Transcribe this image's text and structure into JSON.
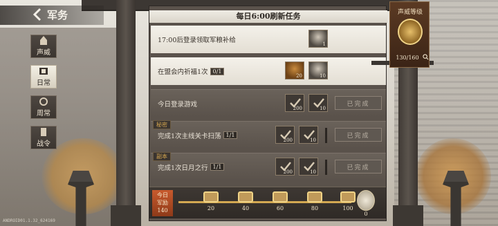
{
  "header": {
    "title": "军务",
    "back_icon": "chevron-left-icon"
  },
  "sidebar": {
    "tabs": [
      {
        "label": "声威",
        "icon": "helmet-icon",
        "active": false
      },
      {
        "label": "日常",
        "icon": "scroll-icon",
        "active": true
      },
      {
        "label": "周常",
        "icon": "knot-icon",
        "active": false
      },
      {
        "label": "战令",
        "icon": "seal-icon",
        "active": false
      }
    ]
  },
  "panel": {
    "title": "每日6:00刷新任务",
    "tasks": [
      {
        "text": "17:00后登录领取军粮补给",
        "progress": "",
        "tag": "",
        "status": "available",
        "rewards": [
          {
            "icon": "food-icon",
            "count": "1"
          }
        ]
      },
      {
        "text": "在盟会内祈福1次",
        "progress": "0/1",
        "tag": "",
        "status": "pending",
        "rewards": [
          {
            "icon": "coin-icon",
            "count": "20"
          },
          {
            "icon": "helmet-icon",
            "count": "10"
          }
        ]
      },
      {
        "text": "今日登录游戏",
        "progress": "",
        "tag": "",
        "status": "done",
        "rewards": [
          {
            "icon": "coin-icon",
            "count": "200"
          },
          {
            "icon": "helmet-icon",
            "count": "10"
          }
        ],
        "done_label": "已完成"
      },
      {
        "text": "完成1次主线关卡扫荡",
        "progress": "1/1",
        "tag": "秘密",
        "status": "done",
        "rewards": [
          {
            "icon": "coin-icon",
            "count": "200"
          },
          {
            "icon": "helmet-icon",
            "count": "10"
          }
        ],
        "done_label": "已完成"
      },
      {
        "text": "完成1次日月之行",
        "progress": "1/1",
        "tag": "副本",
        "status": "done",
        "rewards": [
          {
            "icon": "coin-icon",
            "count": "200"
          },
          {
            "icon": "helmet-icon",
            "count": "10"
          }
        ],
        "done_label": "已完成"
      }
    ]
  },
  "rewards": {
    "today_label": "今日军励",
    "today_value": "140",
    "milestones": [
      "20",
      "40",
      "60",
      "80",
      "100"
    ],
    "final_count": "0"
  },
  "reputation": {
    "title": "声威等级",
    "value": "130/160"
  },
  "version": "ANDROID01.1.32_624169"
}
